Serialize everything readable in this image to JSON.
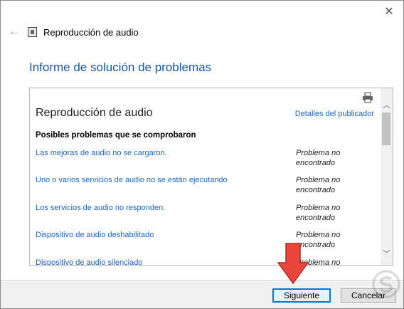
{
  "window": {
    "title": "Reproducción de audio"
  },
  "page": {
    "heading": "Informe de solución de problemas"
  },
  "report": {
    "title": "Reproducción de audio",
    "publisher_link": "Detalles del publicador",
    "section_heading": "Posibles problemas que se comprobaron",
    "rows": [
      {
        "issue": "Las mejoras de audio no se cargaron.",
        "status_line1": "Problema no",
        "status_line2": "encontrado"
      },
      {
        "issue": "Uno o varios servicios de audio no se están ejecutando",
        "status_line1": "Problema no",
        "status_line2": "encontrado"
      },
      {
        "issue": "Los servicios de audio no responden.",
        "status_line1": "Problema no",
        "status_line2": "encontrado"
      },
      {
        "issue": "Dispositivo de audio deshabilitado",
        "status_line1": "Problema no",
        "status_line2": "encontrado"
      },
      {
        "issue": "Dispositivo de audio silenciado",
        "status_line1": "Problema no",
        "status_line2": ""
      }
    ]
  },
  "buttons": {
    "next": "Siguiente",
    "cancel": "Cancelar"
  },
  "icons": {
    "close": "close-icon",
    "back": "back-arrow-icon",
    "app": "audio-troubleshooter-icon",
    "print": "printer-icon",
    "scroll_up": "chevron-up-icon",
    "scroll_down": "chevron-down-icon",
    "annotation": "red-down-arrow-icon"
  },
  "colors": {
    "heading": "#1a56a0",
    "link": "#1a67c0",
    "primary_border": "#0078d7",
    "annotation_arrow": "#e8463c"
  }
}
